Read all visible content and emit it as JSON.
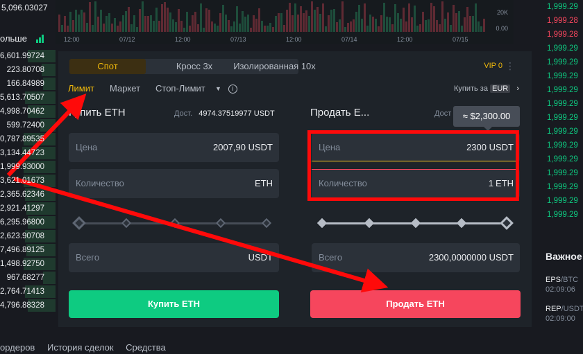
{
  "orderbook": {
    "top_price": "5,096.03027",
    "more_label": "ольше",
    "rows": [
      "6,601.99724",
      "223.80708",
      "166.84989",
      "5,613.70507",
      "4,998.70462",
      "599.72400",
      "0,787.89535",
      "3,134.44723",
      "1,999.93000",
      "3,621.01673",
      "2,365.62346",
      "2,921.41297",
      "6,295.96800",
      "2,623.90708",
      "7,496.89125",
      "1,498.92750",
      "967.68277",
      "2,764.71413",
      "4,796.88328"
    ]
  },
  "bottom_tabs": [
    "ордеров",
    "История сделок",
    "Средства"
  ],
  "chart": {
    "times": [
      "12:00",
      "07/12",
      "12:00",
      "07/13",
      "12:00",
      "07/14",
      "12:00",
      "07/15"
    ],
    "volume_labels": [
      "20K",
      "0.00"
    ]
  },
  "tabs": {
    "spot": "Спот",
    "cross": "Кросс 3x",
    "isolated": "Изолированная 10x"
  },
  "vip_label": "VIP 0",
  "order_types": {
    "limit": "Лимит",
    "market": "Маркет",
    "stop_limit": "Стоп-Лимит"
  },
  "buy_for": {
    "label": "Купить за",
    "currency": "EUR"
  },
  "buy": {
    "title": "Купить ETH",
    "available_label": "Дост.",
    "available_value": "4974.37519977 USDT",
    "price_label": "Цена",
    "price_value": "2007,90",
    "price_unit": "USDT",
    "qty_label": "Количество",
    "qty_unit": "ETH",
    "total_label": "Всего",
    "total_unit": "USDT",
    "button": "Купить ETH"
  },
  "sell": {
    "title": "Продать E...",
    "available_label": "Дост",
    "tooltip": "≈ $2,300.00",
    "price_label": "Цена",
    "price_value": "2300",
    "price_unit": "USDT",
    "qty_label": "Количество",
    "qty_value": "1",
    "qty_unit": "ETH",
    "total_label": "Всего",
    "total_value": "2300,0000000",
    "total_unit": "USDT",
    "button": "Продать ETH"
  },
  "trades": {
    "rows": [
      {
        "p": "1,999.29",
        "d": "up"
      },
      {
        "p": "1,999.28",
        "d": "dn"
      },
      {
        "p": "1,999.28",
        "d": "dn"
      },
      {
        "p": "1,999.29",
        "d": "up"
      },
      {
        "p": "1,999.29",
        "d": "up"
      },
      {
        "p": "1,999.29",
        "d": "up"
      },
      {
        "p": "1,999.29",
        "d": "up"
      },
      {
        "p": "1,999.29",
        "d": "up"
      },
      {
        "p": "1,999.29",
        "d": "up"
      },
      {
        "p": "1,999.29",
        "d": "up"
      },
      {
        "p": "1,999.29",
        "d": "up"
      },
      {
        "p": "1,999.29",
        "d": "up"
      },
      {
        "p": "1,999.29",
        "d": "up"
      },
      {
        "p": "1,999.29",
        "d": "up"
      },
      {
        "p": "1,999.29",
        "d": "up"
      },
      {
        "p": "1,999.29",
        "d": "up"
      }
    ]
  },
  "important": {
    "title": "Важное",
    "news": [
      {
        "pair": "EPS",
        "quote": "/BTC",
        "time": "02:09:06"
      },
      {
        "pair": "REP",
        "quote": "/USDT",
        "time": "02:09:00"
      }
    ]
  },
  "colors": {
    "accent": "#f0b90b",
    "buy": "#0ecb81",
    "sell": "#f6465d",
    "annotation": "#ff0a0a"
  }
}
